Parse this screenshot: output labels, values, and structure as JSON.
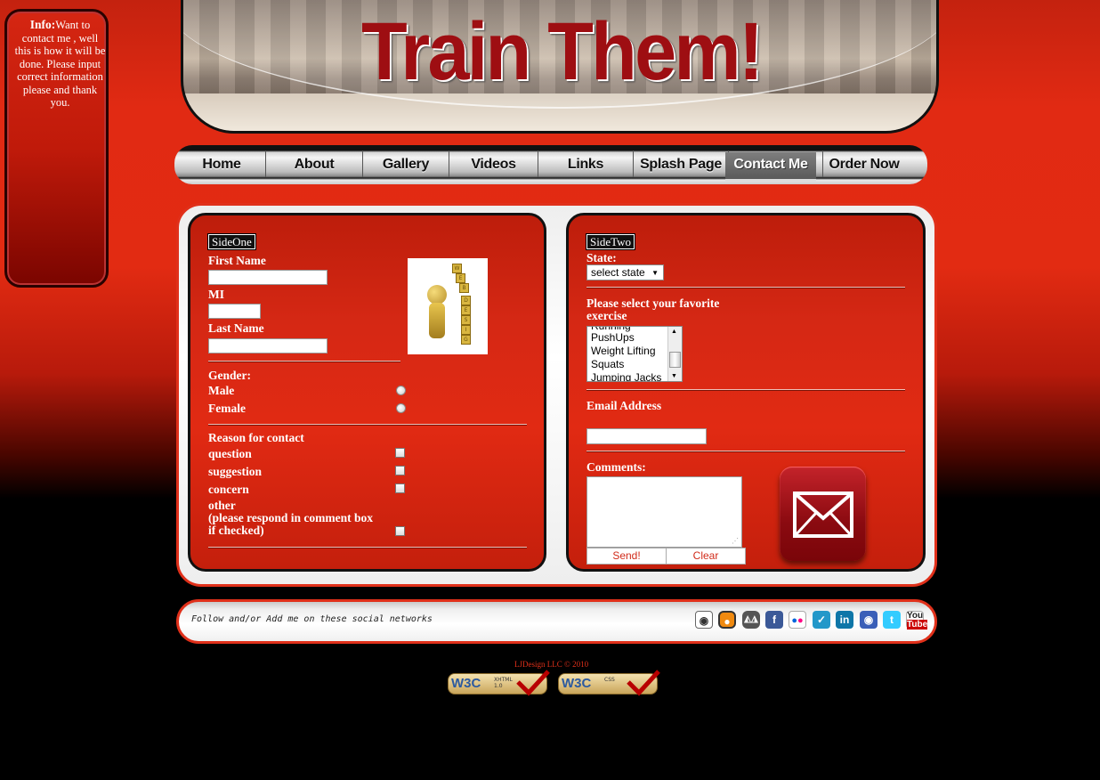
{
  "info": {
    "title": "Info:",
    "text": "Want to contact me , well this is how it will be done. Please input correct information please and thank you."
  },
  "banner": {
    "title": "Train Them!"
  },
  "nav": {
    "items": [
      "Home",
      "About",
      "Gallery",
      "Videos",
      "Links",
      "Splash Page",
      "Contact Me",
      "Order Now"
    ],
    "active": "Contact Me"
  },
  "side_one": {
    "legend": "SideOne",
    "first_name_label": "First Name",
    "mi_label": "MI",
    "last_name_label": "Last Name",
    "gender_label": "Gender:",
    "male_label": "Male",
    "female_label": "Female",
    "reason_label": "Reason for contact",
    "reasons": [
      "question",
      "suggestion",
      "concern"
    ],
    "other_label": "other",
    "other_note_1": "(please respond in comment box",
    "other_note_2": "if checked)"
  },
  "side_two": {
    "legend": "SideTwo",
    "state_label": "State:",
    "state_selected": "select state",
    "exercise_label_1": "Please select your favorite",
    "exercise_label_2": "exercise",
    "exercise_options": [
      "Running",
      "PushUps",
      "Weight Lifting",
      "Squats",
      "Jumping Jacks"
    ],
    "email_label": "Email Address",
    "comments_label": "Comments:",
    "send_label": "Send!",
    "clear_label": "Clear"
  },
  "social": {
    "text": "Follow and/or Add me on these social networks",
    "icons": [
      "skype-icon",
      "lastfm-icon",
      "delicious-icon",
      "facebook-icon",
      "flickr-icon",
      "foursquare-icon",
      "linkedin-icon",
      "myspace-icon",
      "twitter-icon",
      "youtube-icon"
    ]
  },
  "footer": {
    "copyright": "LJDesign LLC © 2010",
    "badges": [
      {
        "w3": "W3C",
        "type": "XHTML",
        "ver": "1.0"
      },
      {
        "w3": "W3C",
        "type": "CSS",
        "ver": ""
      }
    ]
  },
  "colors": {
    "accent": "#e0301a",
    "panel": "#d52814",
    "dark": "#000000"
  }
}
